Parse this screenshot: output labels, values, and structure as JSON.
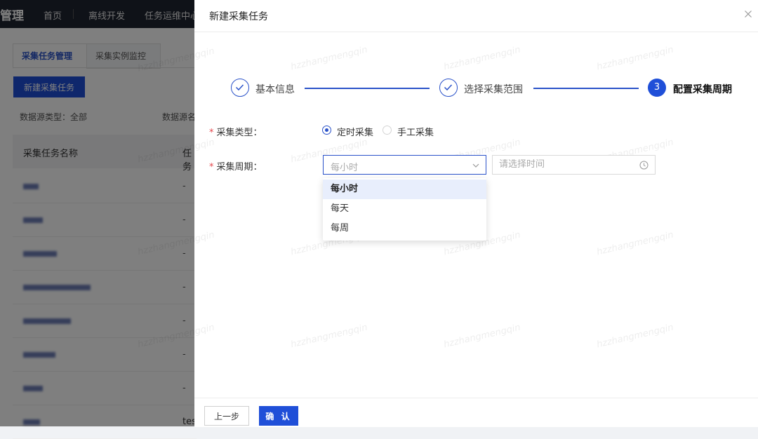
{
  "background": {
    "brand": "管理",
    "nav": [
      "首页",
      "离线开发",
      "任务运维中心"
    ],
    "tabs": [
      "采集任务管理",
      "采集实例监控"
    ],
    "new_button": "新建采集任务",
    "filter_type": "数据源类型：全部",
    "filter_name": "数据源名",
    "table_headers": [
      "采集任务名称",
      "任务"
    ],
    "row_dash": "-",
    "last_row_text": "tes"
  },
  "drawer": {
    "title": "新建采集任务",
    "steps": [
      {
        "label": "基本信息",
        "status": "done"
      },
      {
        "label": "选择采集范围",
        "status": "done"
      },
      {
        "number": "3",
        "label": "配置采集周期",
        "status": "current"
      }
    ],
    "type_label": "采集类型：",
    "type_options": [
      {
        "label": "定时采集",
        "checked": true
      },
      {
        "label": "手工采集",
        "checked": false
      }
    ],
    "cycle_label": "采集周期：",
    "cycle_select_value": "每小时",
    "time_placeholder": "请选择时间",
    "dropdown_options": [
      "每小时",
      "每天",
      "每周"
    ],
    "watermark": "hzzhangmengqin",
    "prev_button": "上一步",
    "confirm_button": "确 认"
  },
  "colors": {
    "primary": "#1f4fd8",
    "required": "#e5484d",
    "topbar": "#1f2430"
  }
}
